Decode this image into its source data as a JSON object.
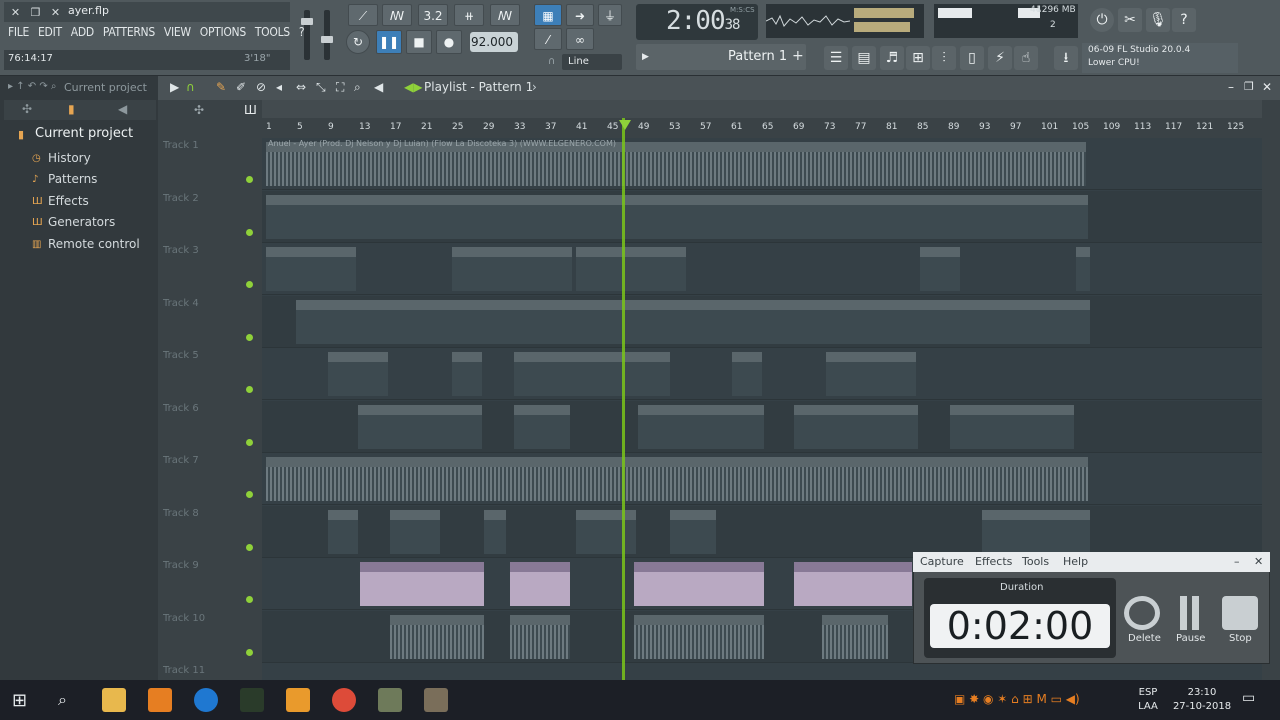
{
  "app": {
    "file_name": "ayer.flp"
  },
  "menu": [
    "FILE",
    "EDIT",
    "ADD",
    "PATTERNS",
    "VIEW",
    "OPTIONS",
    "TOOLS",
    "?"
  ],
  "hint_bar": {
    "time": "76:14:17",
    "length": "3'18\""
  },
  "transport": {
    "tempo": "92.000",
    "snap": "Line",
    "time_main": "2:00",
    "time_sub": "38",
    "time_unit": "M:S:CS"
  },
  "cpu_panel": {
    "value": "44",
    "memory": "1296 MB",
    "polyphony": "2"
  },
  "pattern": {
    "name": "Pattern 1"
  },
  "hint_panel": {
    "line1": "06-09  FL Studio 20.0.4",
    "line2": "Lower CPU!"
  },
  "browser": {
    "header_label": "Current project",
    "root": "Current project",
    "items": [
      {
        "label": "History",
        "icon": "clock-icon"
      },
      {
        "label": "Patterns",
        "icon": "note-icon"
      },
      {
        "label": "Effects",
        "icon": "grid-icon"
      },
      {
        "label": "Generators",
        "icon": "grid-icon"
      },
      {
        "label": "Remote control",
        "icon": "plug-icon"
      }
    ]
  },
  "playlist": {
    "title": "Playlist - Pattern 1",
    "audio_clip": "Anuel - Ayer (Prod. Dj Nelson y Dj Luian) (Flow La Discoteka 3) (WWW.ELGENERO.COM)",
    "ruler": [
      "1",
      "5",
      "9",
      "13",
      "17",
      "21",
      "25",
      "29",
      "33",
      "37",
      "41",
      "45",
      "49",
      "53",
      "57",
      "61",
      "65",
      "69",
      "73",
      "77",
      "81",
      "85",
      "89",
      "93",
      "97",
      "101",
      "105",
      "109",
      "113",
      "117",
      "121",
      "125"
    ],
    "tracks": [
      "Track 1",
      "Track 2",
      "Track 3",
      "Track 4",
      "Track 5",
      "Track 6",
      "Track 7",
      "Track 8",
      "Track 9",
      "Track 10",
      "Track 11"
    ]
  },
  "recorder": {
    "menu": [
      "Capture",
      "Effects",
      "Tools",
      "Help"
    ],
    "duration_label": "Duration",
    "duration": "0:02:00",
    "buttons": [
      "Delete",
      "Pause",
      "Stop"
    ]
  },
  "taskbar": {
    "lang1": "ESP",
    "lang2": "LAA",
    "time": "23:10",
    "date": "27-10-2018"
  }
}
